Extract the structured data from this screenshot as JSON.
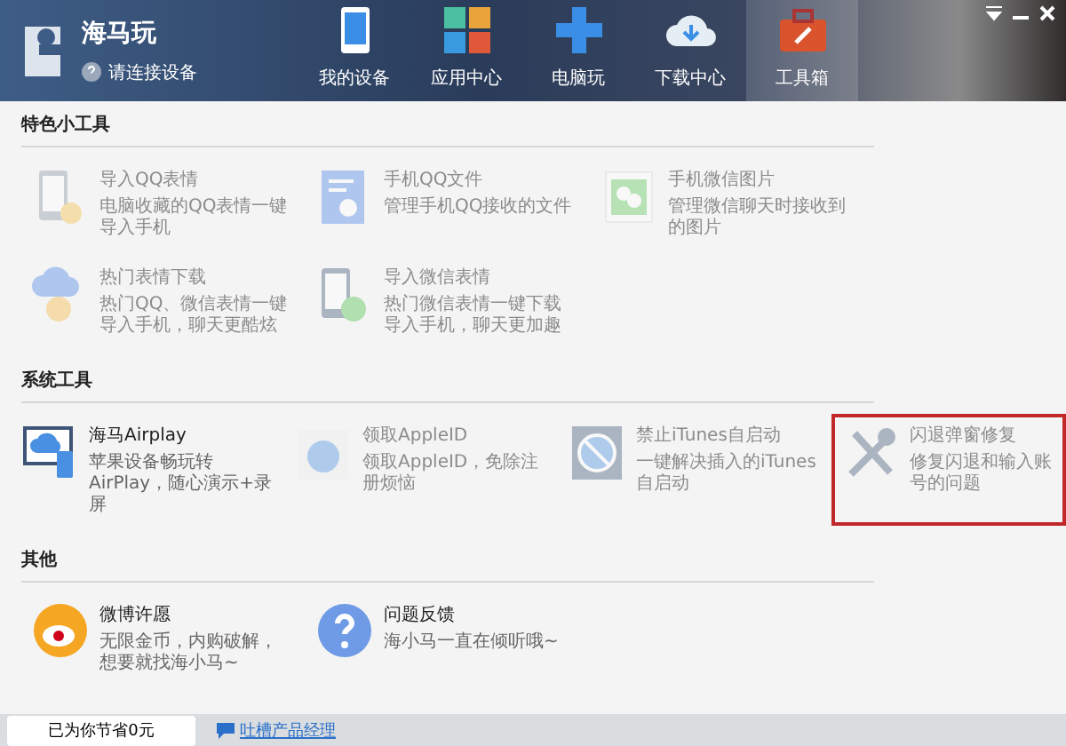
{
  "app": {
    "name": "海马玩",
    "connect_status": "请连接设备"
  },
  "tabs": [
    {
      "label": "我的设备",
      "selected": false
    },
    {
      "label": "应用中心",
      "selected": false
    },
    {
      "label": "电脑玩",
      "selected": false
    },
    {
      "label": "下载中心",
      "selected": false
    },
    {
      "label": "工具箱",
      "selected": true
    }
  ],
  "sections": [
    {
      "title": "特色小工具",
      "items": [
        {
          "title": "导入QQ表情",
          "desc": "电脑收藏的QQ表情一键导入手机",
          "disabled": true,
          "highlighted": false
        },
        {
          "title": "手机QQ文件",
          "desc": "管理手机QQ接收的文件",
          "disabled": true,
          "highlighted": false
        },
        {
          "title": "手机微信图片",
          "desc": "管理微信聊天时接收到的图片",
          "disabled": true,
          "highlighted": false
        },
        {
          "title": "热门表情下载",
          "desc": "热门QQ、微信表情一键导入手机，聊天更酷炫",
          "disabled": true,
          "highlighted": false
        },
        {
          "title": "导入微信表情",
          "desc": "热门微信表情一键下载导入手机，聊天更加趣",
          "disabled": true,
          "highlighted": false
        }
      ]
    },
    {
      "title": "系统工具",
      "items": [
        {
          "title": "海马Airplay",
          "desc": "苹果设备畅玩转AirPlay，随心演示+录屏",
          "disabled": false,
          "highlighted": false
        },
        {
          "title": "领取AppleID",
          "desc": "领取AppleID，免除注册烦恼",
          "disabled": true,
          "highlighted": false
        },
        {
          "title": "禁止iTunes自启动",
          "desc": "一键解决插入的iTunes自启动",
          "disabled": true,
          "highlighted": false
        },
        {
          "title": "闪退弹窗修复",
          "desc": "修复闪退和输入账号的问题",
          "disabled": true,
          "highlighted": true
        }
      ]
    },
    {
      "title": "其他",
      "items": [
        {
          "title": "微博许愿",
          "desc": "无限金币，内购破解，想要就找海小马~",
          "disabled": false,
          "highlighted": false
        },
        {
          "title": "问题反馈",
          "desc": "海小马一直在倾听哦~",
          "disabled": false,
          "highlighted": false
        }
      ]
    }
  ],
  "status_bar": {
    "savings": "已为你节省0元",
    "feedback_link": "吐槽产品经理"
  }
}
